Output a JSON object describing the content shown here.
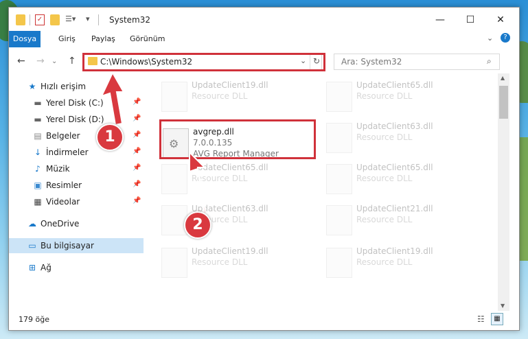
{
  "window": {
    "title": "System32",
    "controls": {
      "minimize": "—",
      "maximize": "☐",
      "close": "✕"
    }
  },
  "ribbon": {
    "tabs": [
      {
        "label": "Dosya",
        "active": true
      },
      {
        "label": "Giriş"
      },
      {
        "label": "Paylaş"
      },
      {
        "label": "Görünüm"
      }
    ]
  },
  "address": {
    "path": "C:\\Windows\\System32",
    "search_placeholder": "Ara: System32"
  },
  "sidebar": {
    "items": [
      {
        "label": "Hızlı erişim",
        "icon": "star-icon"
      },
      {
        "label": "Yerel Disk (C:)",
        "icon": "drive-icon",
        "pinned": true
      },
      {
        "label": "Yerel Disk (D:)",
        "icon": "drive-icon",
        "pinned": true
      },
      {
        "label": "Belgeler",
        "icon": "document-icon",
        "pinned": true
      },
      {
        "label": "İndirmeler",
        "icon": "download-icon",
        "pinned": true
      },
      {
        "label": "Müzik",
        "icon": "music-icon",
        "pinned": true
      },
      {
        "label": "Resimler",
        "icon": "pictures-icon",
        "pinned": true
      },
      {
        "label": "Videolar",
        "icon": "video-icon",
        "pinned": true
      },
      {
        "label": "OneDrive",
        "icon": "cloud-icon"
      },
      {
        "label": "Bu bilgisayar",
        "icon": "computer-icon",
        "selected": true
      },
      {
        "label": "Ağ",
        "icon": "network-icon"
      }
    ]
  },
  "files": {
    "highlighted": {
      "name": "avgrep.dll",
      "version": "7.0.0.135",
      "description": "AVG Report Manager"
    },
    "ghost": [
      {
        "name": "UpdateClient19.dll",
        "desc": "Resource DLL"
      },
      {
        "name": "UpdateClient65.dll",
        "desc": "Resource DLL"
      },
      {
        "name": "UpdateClient63.dll",
        "desc": "Resource DLL"
      },
      {
        "name": "UpdateClient65.dll",
        "desc": "Resource DLL"
      },
      {
        "name": "UpdateClient65.dll",
        "desc": "Resource DLL"
      },
      {
        "name": "UpdateClient63.dll",
        "desc": "Resource DLL"
      },
      {
        "name": "UpdateClient21.dll",
        "desc": "Resource DLL"
      },
      {
        "name": "UpdateClient19.dll",
        "desc": "Resource DLL"
      },
      {
        "name": "UpdateClient19.dll",
        "desc": "Resource DLL"
      }
    ]
  },
  "status": {
    "count": "179 öğe"
  },
  "annotations": {
    "step1": "1",
    "step2": "2",
    "color": "#d0313a"
  }
}
